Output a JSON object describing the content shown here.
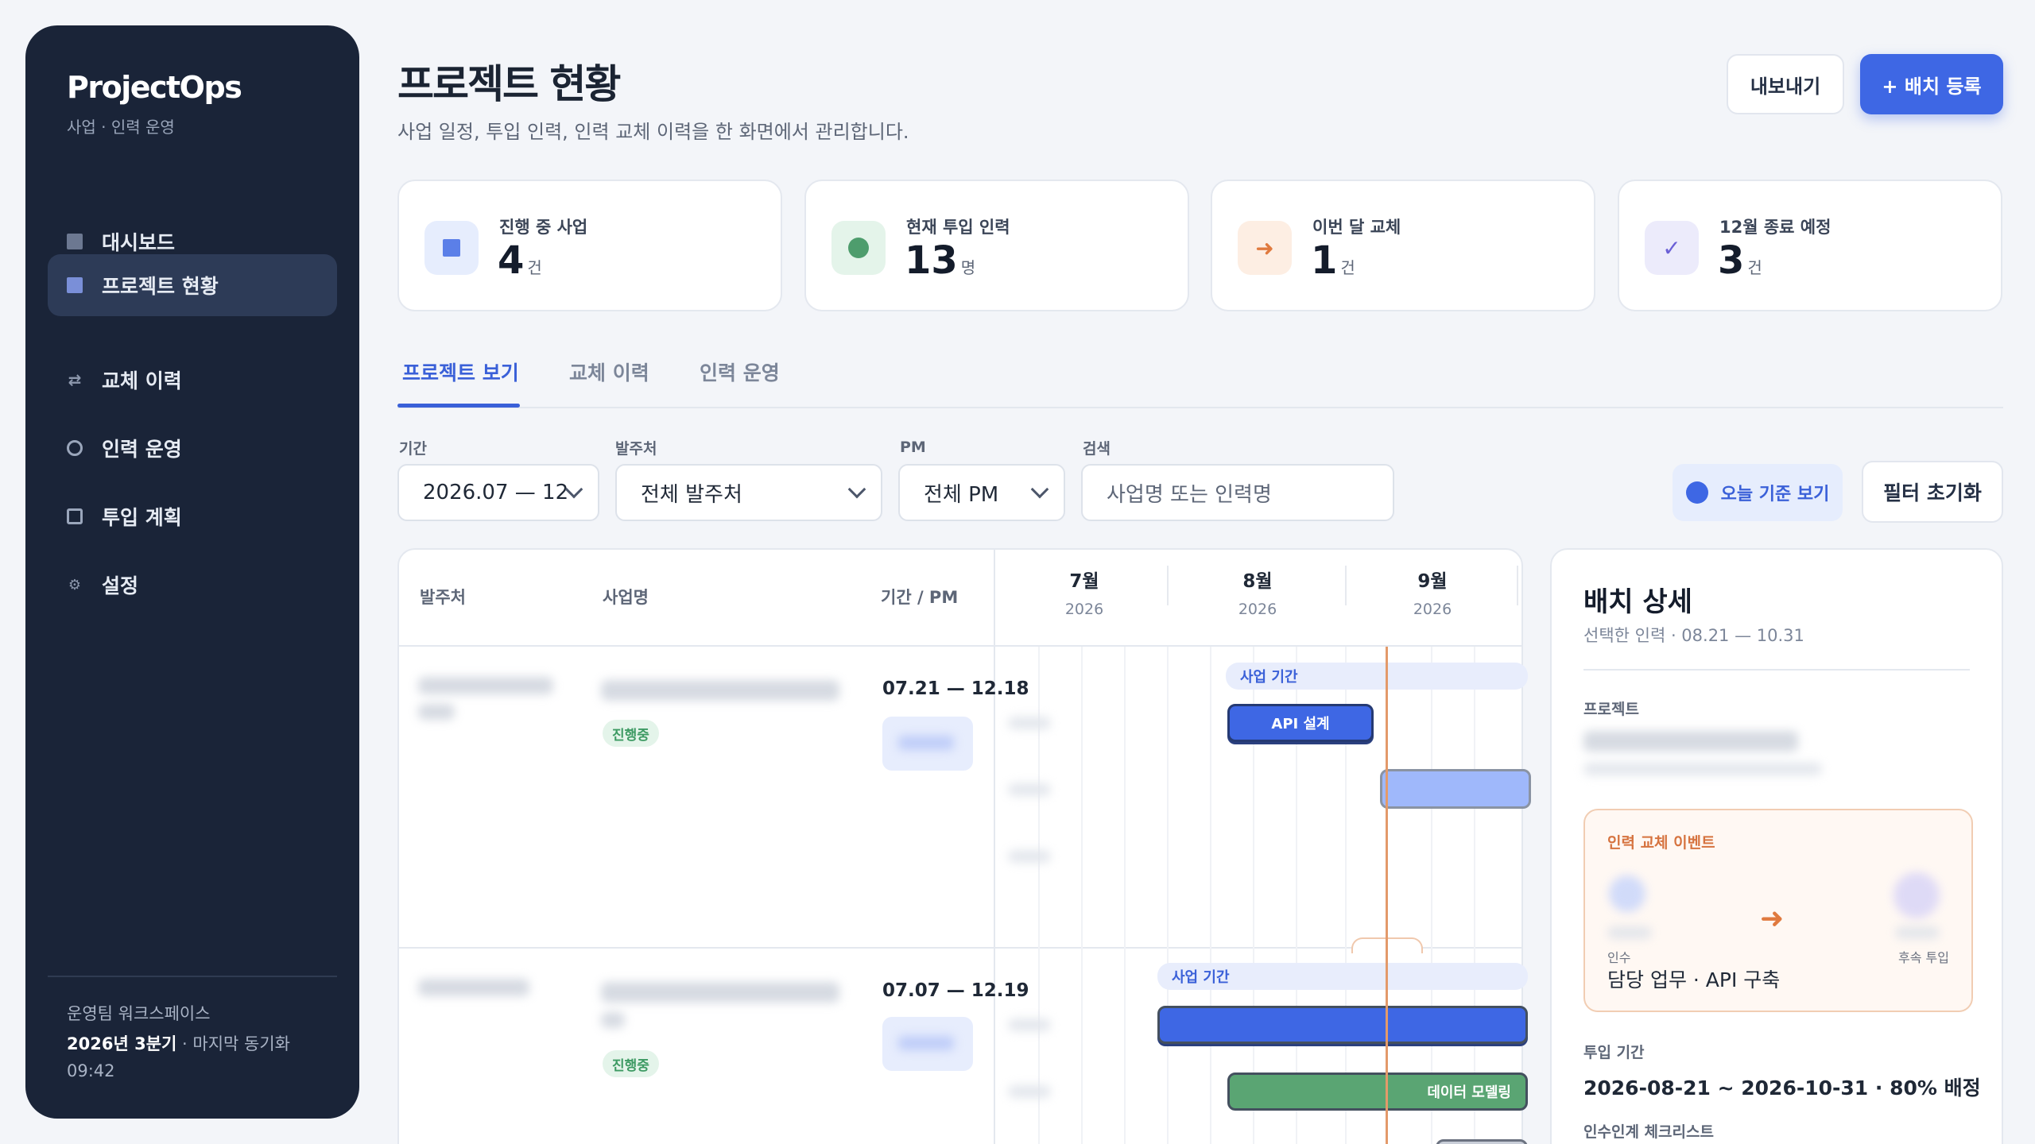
{
  "sidebar": {
    "logo": "ProjectOps",
    "subtitle": "사업 · 인력 운영",
    "items": [
      {
        "label": "대시보드"
      },
      {
        "label": "프로젝트 현황"
      },
      {
        "label": "교체 이력"
      },
      {
        "label": "인력 운영"
      },
      {
        "label": "투입 계획"
      },
      {
        "label": "설정"
      }
    ],
    "footer": {
      "workspace": "운영팀 워크스페이스",
      "quarter": "2026년 3분기",
      "sync_label": " · 마지막 동기화",
      "time": "09:42"
    }
  },
  "header": {
    "title": "프로젝트 현황",
    "subtitle": "사업 일정, 투입 인력, 인력 교체 이력을 한 화면에서 관리합니다.",
    "export_label": "내보내기",
    "add_label": "+ 배치 등록"
  },
  "stats": [
    {
      "label": "진행 중 사업",
      "value": "4",
      "unit": "건",
      "icon": "square-icon",
      "color": "#5b7fe8"
    },
    {
      "label": "현재 투입 인력",
      "value": "13",
      "unit": "명",
      "icon": "dot-icon",
      "color": "#4e9d6d"
    },
    {
      "label": "이번 달 교체",
      "value": "1",
      "unit": "건",
      "icon": "arrow-right-icon",
      "color": "#e07a3f"
    },
    {
      "label": "12월 종료 예정",
      "value": "3",
      "unit": "건",
      "icon": "check-icon",
      "color": "#6a5fd6"
    }
  ],
  "tabs": [
    {
      "label": "프로젝트 보기",
      "active": true
    },
    {
      "label": "교체 이력",
      "active": false
    },
    {
      "label": "인력 운영",
      "active": false
    }
  ],
  "filters": {
    "period": {
      "label": "기간",
      "value": "2026.07 — 12"
    },
    "client": {
      "label": "발주처",
      "value": "전체 발주처"
    },
    "pm": {
      "label": "PM",
      "value": "전체 PM"
    },
    "search": {
      "label": "검색",
      "placeholder": "사업명 또는 인력명"
    },
    "today_label": "오늘 기준 보기",
    "reset_label": "필터 초기화"
  },
  "table": {
    "columns": [
      "발주처",
      "사업명",
      "기간 / PM"
    ],
    "months": [
      {
        "month": "7월",
        "year": "2026"
      },
      {
        "month": "8월",
        "year": "2026"
      },
      {
        "month": "9월",
        "year": "2026"
      }
    ],
    "rows": [
      {
        "status": "진행중",
        "period": "07.21 — 12.18",
        "range_label": "사업 기간",
        "bars": [
          {
            "label": "API 설계"
          },
          {
            "label": ""
          }
        ]
      },
      {
        "status": "진행중",
        "period": "07.07 — 12.19",
        "range_label": "사업 기간",
        "bars": [
          {
            "label": ""
          },
          {
            "label": "데이터 모델링"
          }
        ]
      }
    ]
  },
  "detail": {
    "title": "배치 상세",
    "subtitle": "선택한 인력 · 08.21 — 10.31",
    "project_label": "프로젝트",
    "event": {
      "title": "인력 교체 이벤트",
      "from_role": "인수",
      "duty": "담당 업무 · API 구축",
      "to_role": "후속 투입"
    },
    "period_label": "투입 기간",
    "period_value": "2026-08-21 ~ 2026-10-31 · 80% 배정",
    "checklist_label": "인수인계 체크리스트"
  }
}
